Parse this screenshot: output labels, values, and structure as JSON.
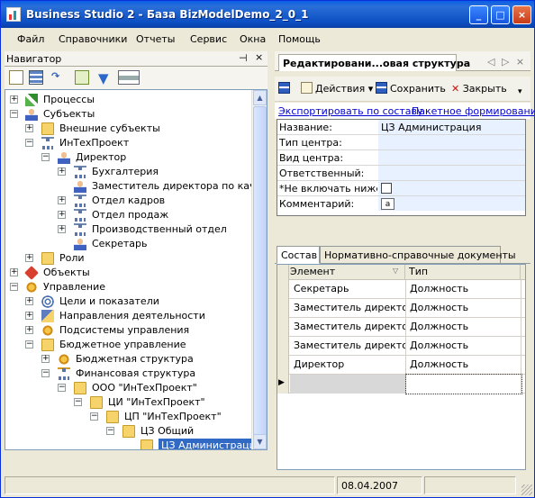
{
  "window": {
    "title": "Business Studio 2 - База BizModelDemo_2_0_1",
    "min": "_",
    "max": "□",
    "close": "×"
  },
  "menu": [
    "Файл",
    "Справочники",
    "Отчеты",
    "Сервис",
    "Окна",
    "Помощь"
  ],
  "navigator": {
    "title": "Навигатор",
    "pin": "⊣",
    "close": "×",
    "tree": [
      {
        "label": "Процессы",
        "exp": "+",
        "icon": "process-icon"
      },
      {
        "label": "Субъекты",
        "exp": "−",
        "icon": "subjects-icon"
      },
      {
        "label": "Внешние субъекты",
        "exp": "+",
        "icon": "folder-icon"
      },
      {
        "label": "ИнТехПроект",
        "exp": "−",
        "icon": "org-icon"
      },
      {
        "label": "Директор",
        "exp": "−",
        "icon": "person-icon"
      },
      {
        "label": "Бухгалтерия",
        "exp": "+",
        "icon": "org-icon"
      },
      {
        "label": "Заместитель директора по качест",
        "exp": "",
        "icon": "person-icon"
      },
      {
        "label": "Отдел кадров",
        "exp": "+",
        "icon": "org-icon"
      },
      {
        "label": "Отдел продаж",
        "exp": "+",
        "icon": "org-icon"
      },
      {
        "label": "Производственный отдел",
        "exp": "+",
        "icon": "org-icon"
      },
      {
        "label": "Секретарь",
        "exp": "",
        "icon": "person-icon"
      },
      {
        "label": "Роли",
        "exp": "+",
        "icon": "folder-icon"
      },
      {
        "label": "Объекты",
        "exp": "+",
        "icon": "object-icon"
      },
      {
        "label": "Управление",
        "exp": "−",
        "icon": "management-icon"
      },
      {
        "label": "Цели и показатели",
        "exp": "+",
        "icon": "bsc-icon"
      },
      {
        "label": "Направления деятельности",
        "exp": "+",
        "icon": "direction-icon"
      },
      {
        "label": "Подсистемы управления",
        "exp": "+",
        "icon": "gear-icon"
      },
      {
        "label": "Бюджетное управление",
        "exp": "−",
        "icon": "folder-open-icon"
      },
      {
        "label": "Бюджетная структура",
        "exp": "+",
        "icon": "budget-icon"
      },
      {
        "label": "Финансовая структура",
        "exp": "−",
        "icon": "finance-icon"
      },
      {
        "label": "ООО \"ИнТехПроект\"",
        "exp": "−",
        "icon": "folder-icon"
      },
      {
        "label": "ЦИ \"ИнТехПроект\"",
        "exp": "−",
        "icon": "folder-icon"
      },
      {
        "label": "ЦП \"ИнТехПроект\"",
        "exp": "−",
        "icon": "folder-icon"
      },
      {
        "label": "ЦЗ Общий",
        "exp": "−",
        "icon": "folder-icon"
      },
      {
        "label": "ЦЗ Администрация",
        "exp": "",
        "icon": "folder-icon"
      }
    ]
  },
  "editor": {
    "tab": "Редактировани...овая структура",
    "nav": "◁ ▷ ×",
    "actions": "Действия",
    "save": "Сохранить",
    "close": "Закрыть",
    "export": "Экспортировать по составу",
    "batch": "Пакетное формирование",
    "properties": [
      {
        "label": "Название:",
        "value": "ЦЗ Администрация"
      },
      {
        "label": "Тип центра:",
        "value": ""
      },
      {
        "label": "Вид центра:",
        "value": ""
      },
      {
        "label": "Ответственный:",
        "value": ""
      },
      {
        "label": "*Не включать ниже:",
        "value": ""
      },
      {
        "label": "Комментарий:",
        "value": "a"
      }
    ],
    "tabs": [
      "Состав",
      "Нормативно-справочные документы"
    ],
    "grid": {
      "columns": [
        "Элемент",
        "Тип"
      ],
      "rows": [
        [
          "Секретарь",
          "Должность"
        ],
        [
          "Заместитель директо...",
          "Должность"
        ],
        [
          "Заместитель директо...",
          "Должность"
        ],
        [
          "Заместитель директо...",
          "Должность"
        ],
        [
          "Директор",
          "Должность"
        ],
        [
          "",
          ""
        ]
      ]
    }
  },
  "status": {
    "date": "08.04.2007"
  }
}
